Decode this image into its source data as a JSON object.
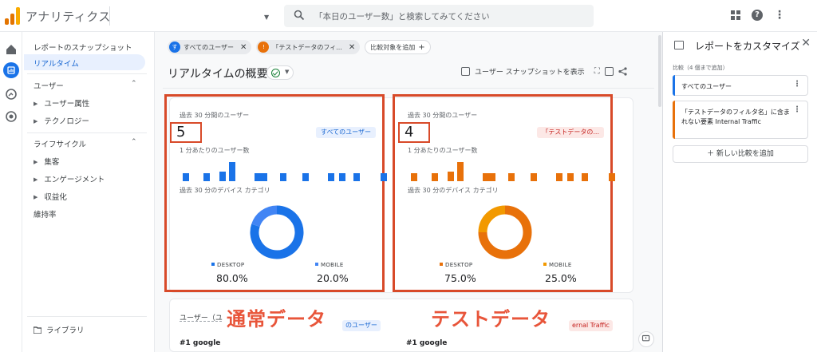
{
  "app": {
    "title": "アナリティクス"
  },
  "search": {
    "placeholder": "「本日のユーザー数」と検索してみてください"
  },
  "nav": {
    "snapshot": "レポートのスナップショット",
    "realtime": "リアルタイム",
    "user_section": "ユーザー",
    "user_attr": "ユーザー属性",
    "tech": "テクノロジー",
    "lifecycle": "ライフサイクル",
    "acquisition": "集客",
    "engagement": "エンゲージメント",
    "monetization": "収益化",
    "retention": "維持率",
    "library": "ライブラリ"
  },
  "chips": {
    "all_users": "すべてのユーザー",
    "test_filter": "「テストデータのフィ...",
    "add_compare": "比較対象を追加",
    "all_users_avatar": "す",
    "test_avatar": "!"
  },
  "main": {
    "title": "リアルタイムの概要",
    "snapshot_btn": "ユーザー スナップショットを表示"
  },
  "panels": [
    {
      "users_label": "過去 30 分間のユーザー",
      "users_value": "5",
      "tag": "すべてのユーザー",
      "per_minute_label": "1 分あたりのユーザー数",
      "device_label": "過去 30 分のデバイス カテゴリ",
      "desktop_label": "DESKTOP",
      "desktop_pct": "80.0%",
      "mobile_label": "MOBILE",
      "mobile_pct": "20.0%",
      "color": "#1a73e8",
      "color_light": "#4285f4"
    },
    {
      "users_label": "過去 30 分間のユーザー",
      "users_value": "4",
      "tag": "「テストデータの...",
      "per_minute_label": "1 分あたりのユーザー数",
      "device_label": "過去 30 分のデバイス カテゴリ",
      "desktop_label": "DESKTOP",
      "desktop_pct": "75.0%",
      "mobile_label": "MOBILE",
      "mobile_pct": "25.0%",
      "color": "#e8710a",
      "color_light": "#f29900"
    }
  ],
  "bottom": {
    "users_label": "ユーザー（ユ",
    "left_tag": "のユーザー",
    "right_tag": "ernal Traffic",
    "left_rank": "#1 google",
    "right_rank": "#1 google"
  },
  "annotations": {
    "normal": "通常データ",
    "test": "テストデータ"
  },
  "right_panel": {
    "title": "レポートをカスタマイズ",
    "compare_label": "比較（4 個まで追加）",
    "item1": "すべてのユーザー",
    "item2": "「テストデータのフィルタ名」に含まれない要素 Internal Traffic",
    "add_new": "＋ 新しい比較を追加"
  },
  "colors": {
    "accent": "#1a73e8",
    "orange": "#e8710a",
    "annotation": "#d84a29"
  }
}
